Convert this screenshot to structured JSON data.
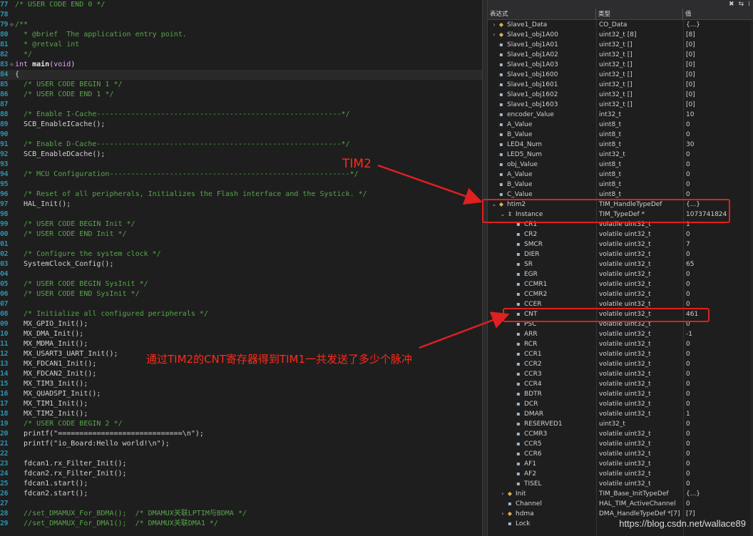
{
  "code_lines": [
    {
      "n": "77",
      "kind": "comment",
      "text": "/* USER CODE END 0 */"
    },
    {
      "n": "78",
      "kind": "blank",
      "text": ""
    },
    {
      "n": "79",
      "kind": "comment",
      "text": "/**",
      "fold": "⊖"
    },
    {
      "n": "80",
      "kind": "comment",
      "text": "  * @brief  The application entry point."
    },
    {
      "n": "81",
      "kind": "comment",
      "text": "  * @retval int"
    },
    {
      "n": "82",
      "kind": "comment",
      "text": "  */"
    },
    {
      "n": "83",
      "kind": "sig",
      "text": "",
      "fold": "⊖",
      "sig": {
        "kw1": "int ",
        "fn": "main",
        "p1": "(",
        "kw2": "void",
        "p2": ")"
      }
    },
    {
      "n": "84",
      "kind": "code",
      "text": "{",
      "hl": true
    },
    {
      "n": "85",
      "kind": "comment",
      "text": "  /* USER CODE BEGIN 1 */"
    },
    {
      "n": "86",
      "kind": "comment",
      "text": "  /* USER CODE END 1 */"
    },
    {
      "n": "87",
      "kind": "blank",
      "text": ""
    },
    {
      "n": "88",
      "kind": "comment",
      "text": "  /* Enable I-Cache---------------------------------------------------------*/"
    },
    {
      "n": "89",
      "kind": "code",
      "text": "  SCB_EnableICache();"
    },
    {
      "n": "90",
      "kind": "blank",
      "text": ""
    },
    {
      "n": "91",
      "kind": "comment",
      "text": "  /* Enable D-Cache---------------------------------------------------------*/"
    },
    {
      "n": "92",
      "kind": "code",
      "text": "  SCB_EnableDCache();"
    },
    {
      "n": "93",
      "kind": "blank",
      "text": ""
    },
    {
      "n": "94",
      "kind": "comment",
      "text": "  /* MCU Configuration--------------------------------------------------------*/"
    },
    {
      "n": "95",
      "kind": "blank",
      "text": ""
    },
    {
      "n": "96",
      "kind": "comment",
      "text": "  /* Reset of all peripherals, Initializes the Flash interface and the Systick. */"
    },
    {
      "n": "97",
      "kind": "code",
      "text": "  HAL_Init();"
    },
    {
      "n": "98",
      "kind": "blank",
      "text": ""
    },
    {
      "n": "99",
      "kind": "comment",
      "text": "  /* USER CODE BEGIN Init */"
    },
    {
      "n": "00",
      "kind": "comment",
      "text": "  /* USER CODE END Init */"
    },
    {
      "n": "01",
      "kind": "blank",
      "text": ""
    },
    {
      "n": "02",
      "kind": "comment",
      "text": "  /* Configure the system clock */"
    },
    {
      "n": "03",
      "kind": "code",
      "text": "  SystemClock_Config();"
    },
    {
      "n": "04",
      "kind": "blank",
      "text": ""
    },
    {
      "n": "05",
      "kind": "comment",
      "text": "  /* USER CODE BEGIN SysInit */"
    },
    {
      "n": "06",
      "kind": "comment",
      "text": "  /* USER CODE END SysInit */"
    },
    {
      "n": "07",
      "kind": "blank",
      "text": ""
    },
    {
      "n": "08",
      "kind": "comment",
      "text": "  /* Initialize all configured peripherals */"
    },
    {
      "n": "09",
      "kind": "code",
      "text": "  MX_GPIO_Init();"
    },
    {
      "n": "10",
      "kind": "code",
      "text": "  MX_DMA_Init();"
    },
    {
      "n": "11",
      "kind": "code",
      "text": "  MX_MDMA_Init();"
    },
    {
      "n": "12",
      "kind": "code",
      "text": "  MX_USART3_UART_Init();"
    },
    {
      "n": "13",
      "kind": "code",
      "text": "  MX_FDCAN1_Init();"
    },
    {
      "n": "14",
      "kind": "code",
      "text": "  MX_FDCAN2_Init();"
    },
    {
      "n": "15",
      "kind": "code",
      "text": "  MX_TIM3_Init();"
    },
    {
      "n": "16",
      "kind": "code",
      "text": "  MX_QUADSPI_Init();"
    },
    {
      "n": "17",
      "kind": "code",
      "text": "  MX_TIM1_Init();"
    },
    {
      "n": "18",
      "kind": "code",
      "text": "  MX_TIM2_Init();"
    },
    {
      "n": "19",
      "kind": "comment",
      "text": "  /* USER CODE BEGIN 2 */"
    },
    {
      "n": "20",
      "kind": "code",
      "text": "  printf(\"=============================\\n\");"
    },
    {
      "n": "21",
      "kind": "code",
      "text": "  printf(\"io_Board:Hello world!\\n\");"
    },
    {
      "n": "22",
      "kind": "blank",
      "text": ""
    },
    {
      "n": "23",
      "kind": "code",
      "text": "  fdcan1.rx_Filter_Init();"
    },
    {
      "n": "24",
      "kind": "code",
      "text": "  fdcan2.rx_Filter_Init();"
    },
    {
      "n": "25",
      "kind": "code",
      "text": "  fdcan1.start();"
    },
    {
      "n": "26",
      "kind": "code",
      "text": "  fdcan2.start();"
    },
    {
      "n": "27",
      "kind": "blank",
      "text": ""
    },
    {
      "n": "28",
      "kind": "comment",
      "text": "  //set_DMAMUX_For_BDMA();  /* DMAMUX关联LPTIM与BDMA */"
    },
    {
      "n": "29",
      "kind": "comment",
      "text": "  //set_DMAMUX_For_DMA1();  /* DMAMUX关联DMA1 */"
    }
  ],
  "watch": {
    "topbar_icons": [
      "✖",
      "⇆",
      "⁞"
    ],
    "columns": {
      "name": "表达式",
      "type": "类型",
      "value": "值"
    },
    "rows": [
      {
        "name": "Slave1_Data",
        "type": "CO_Data",
        "value": "{...}",
        "exp": "›",
        "icon": "obj",
        "indent": 0
      },
      {
        "name": "Slave1_obj1A00",
        "type": "uint32_t [8]",
        "value": "[8]",
        "exp": "›",
        "icon": "obj",
        "indent": 0
      },
      {
        "name": "Slave1_obj1A01",
        "type": "uint32_t []",
        "value": "[0]",
        "exp": "",
        "icon": "var",
        "indent": 0
      },
      {
        "name": "Slave1_obj1A02",
        "type": "uint32_t []",
        "value": "[0]",
        "exp": "",
        "icon": "var",
        "indent": 0
      },
      {
        "name": "Slave1_obj1A03",
        "type": "uint32_t []",
        "value": "[0]",
        "exp": "",
        "icon": "var",
        "indent": 0
      },
      {
        "name": "Slave1_obj1600",
        "type": "uint32_t []",
        "value": "[0]",
        "exp": "",
        "icon": "var",
        "indent": 0
      },
      {
        "name": "Slave1_obj1601",
        "type": "uint32_t []",
        "value": "[0]",
        "exp": "",
        "icon": "var",
        "indent": 0
      },
      {
        "name": "Slave1_obj1602",
        "type": "uint32_t []",
        "value": "[0]",
        "exp": "",
        "icon": "var",
        "indent": 0
      },
      {
        "name": "Slave1_obj1603",
        "type": "uint32_t []",
        "value": "[0]",
        "exp": "",
        "icon": "var",
        "indent": 0
      },
      {
        "name": "encoder_Value",
        "type": "int32_t",
        "value": "10",
        "exp": "",
        "icon": "var",
        "indent": 0
      },
      {
        "name": "A_Value",
        "type": "uint8_t",
        "value": "0",
        "exp": "",
        "icon": "var",
        "indent": 0
      },
      {
        "name": "B_Value",
        "type": "uint8_t",
        "value": "0",
        "exp": "",
        "icon": "var",
        "indent": 0
      },
      {
        "name": "LED4_Num",
        "type": "uint8_t",
        "value": "30",
        "exp": "",
        "icon": "var",
        "indent": 0
      },
      {
        "name": "LED5_Num",
        "type": "uint32_t",
        "value": "0",
        "exp": "",
        "icon": "var",
        "indent": 0
      },
      {
        "name": "obj_Value",
        "type": "uint8_t",
        "value": "0",
        "exp": "",
        "icon": "var",
        "indent": 0
      },
      {
        "name": "A_Value",
        "type": "uint8_t",
        "value": "0",
        "exp": "",
        "icon": "var",
        "indent": 0
      },
      {
        "name": "B_Value",
        "type": "uint8_t",
        "value": "0",
        "exp": "",
        "icon": "var",
        "indent": 0
      },
      {
        "name": "C_Value",
        "type": "uint8_t",
        "value": "0",
        "exp": "",
        "icon": "var",
        "indent": 0
      },
      {
        "name": "htim2",
        "type": "TIM_HandleTypeDef",
        "value": "{...}",
        "exp": "⌄",
        "icon": "obj",
        "indent": 0
      },
      {
        "name": "Instance",
        "type": "TIM_TypeDef *",
        "value": "1073741824",
        "exp": "⌄",
        "icon": "ptr",
        "indent": 1
      },
      {
        "name": "CR1",
        "type": "volatile uint32_t",
        "value": "1",
        "exp": "",
        "icon": "var",
        "indent": 2
      },
      {
        "name": "CR2",
        "type": "volatile uint32_t",
        "value": "0",
        "exp": "",
        "icon": "var",
        "indent": 2
      },
      {
        "name": "SMCR",
        "type": "volatile uint32_t",
        "value": "7",
        "exp": "",
        "icon": "var",
        "indent": 2
      },
      {
        "name": "DIER",
        "type": "volatile uint32_t",
        "value": "0",
        "exp": "",
        "icon": "var",
        "indent": 2
      },
      {
        "name": "SR",
        "type": "volatile uint32_t",
        "value": "65",
        "exp": "",
        "icon": "var",
        "indent": 2
      },
      {
        "name": "EGR",
        "type": "volatile uint32_t",
        "value": "0",
        "exp": "",
        "icon": "var",
        "indent": 2
      },
      {
        "name": "CCMR1",
        "type": "volatile uint32_t",
        "value": "0",
        "exp": "",
        "icon": "var",
        "indent": 2
      },
      {
        "name": "CCMR2",
        "type": "volatile uint32_t",
        "value": "0",
        "exp": "",
        "icon": "var",
        "indent": 2
      },
      {
        "name": "CCER",
        "type": "volatile uint32_t",
        "value": "0",
        "exp": "",
        "icon": "var",
        "indent": 2
      },
      {
        "name": "CNT",
        "type": "volatile uint32_t",
        "value": "461",
        "exp": "",
        "icon": "var",
        "indent": 2
      },
      {
        "name": "PSC",
        "type": "volatile uint32_t",
        "value": "0",
        "exp": "",
        "icon": "var",
        "indent": 2
      },
      {
        "name": "ARR",
        "type": "volatile uint32_t",
        "value": "-1",
        "exp": "",
        "icon": "var",
        "indent": 2
      },
      {
        "name": "RCR",
        "type": "volatile uint32_t",
        "value": "0",
        "exp": "",
        "icon": "var",
        "indent": 2
      },
      {
        "name": "CCR1",
        "type": "volatile uint32_t",
        "value": "0",
        "exp": "",
        "icon": "var",
        "indent": 2
      },
      {
        "name": "CCR2",
        "type": "volatile uint32_t",
        "value": "0",
        "exp": "",
        "icon": "var",
        "indent": 2
      },
      {
        "name": "CCR3",
        "type": "volatile uint32_t",
        "value": "0",
        "exp": "",
        "icon": "var",
        "indent": 2
      },
      {
        "name": "CCR4",
        "type": "volatile uint32_t",
        "value": "0",
        "exp": "",
        "icon": "var",
        "indent": 2
      },
      {
        "name": "BDTR",
        "type": "volatile uint32_t",
        "value": "0",
        "exp": "",
        "icon": "var",
        "indent": 2
      },
      {
        "name": "DCR",
        "type": "volatile uint32_t",
        "value": "0",
        "exp": "",
        "icon": "var",
        "indent": 2
      },
      {
        "name": "DMAR",
        "type": "volatile uint32_t",
        "value": "1",
        "exp": "",
        "icon": "var",
        "indent": 2
      },
      {
        "name": "RESERVED1",
        "type": "uint32_t",
        "value": "0",
        "exp": "",
        "icon": "var",
        "indent": 2
      },
      {
        "name": "CCMR3",
        "type": "volatile uint32_t",
        "value": "0",
        "exp": "",
        "icon": "var",
        "indent": 2
      },
      {
        "name": "CCR5",
        "type": "volatile uint32_t",
        "value": "0",
        "exp": "",
        "icon": "var",
        "indent": 2
      },
      {
        "name": "CCR6",
        "type": "volatile uint32_t",
        "value": "0",
        "exp": "",
        "icon": "var",
        "indent": 2
      },
      {
        "name": "AF1",
        "type": "volatile uint32_t",
        "value": "0",
        "exp": "",
        "icon": "var",
        "indent": 2
      },
      {
        "name": "AF2",
        "type": "volatile uint32_t",
        "value": "0",
        "exp": "",
        "icon": "var",
        "indent": 2
      },
      {
        "name": "TISEL",
        "type": "volatile uint32_t",
        "value": "0",
        "exp": "",
        "icon": "var",
        "indent": 2
      },
      {
        "name": "Init",
        "type": "TIM_Base_InitTypeDef",
        "value": "{...}",
        "exp": "›",
        "icon": "obj",
        "indent": 1
      },
      {
        "name": "Channel",
        "type": "HAL_TIM_ActiveChannel",
        "value": "0",
        "exp": "",
        "icon": "var",
        "indent": 1
      },
      {
        "name": "hdma",
        "type": "DMA_HandleTypeDef *[7]",
        "value": "[7]",
        "exp": "›",
        "icon": "obj",
        "indent": 1
      },
      {
        "name": "Lock",
        "type": "",
        "value": "",
        "exp": "",
        "icon": "var",
        "indent": 1
      }
    ]
  },
  "annotations": {
    "tim2_label": "TIM2",
    "cnt_note": "通过TIM2的CNT寄存器得到TIM1一共发送了多少个脉冲",
    "color": "#e02020"
  },
  "watermark": "https://blog.csdn.net/wallace89"
}
